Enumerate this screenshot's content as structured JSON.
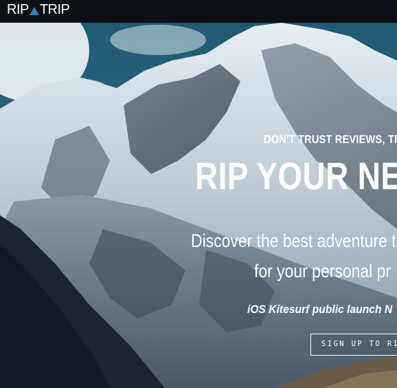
{
  "app": {
    "brand_left": "RIP",
    "brand_right": "TRIP",
    "brand_mark_icon": "triangle-a-icon"
  },
  "hero": {
    "kicker": "DON'T TRUST REVIEWS, TR",
    "headline": "RIP YOUR NEX",
    "subline_1": "Discover the best adventure t",
    "subline_2": "for your personal pr",
    "launch_note": "iOS Kitesurf public launch N",
    "cta_label": "SIGN UP TO RIP",
    "background": "mountain-photo"
  },
  "colors": {
    "nav_bg": "#0d1014",
    "sky": "#2f6e86",
    "accent": "#2f86c8",
    "text": "#ffffff"
  }
}
